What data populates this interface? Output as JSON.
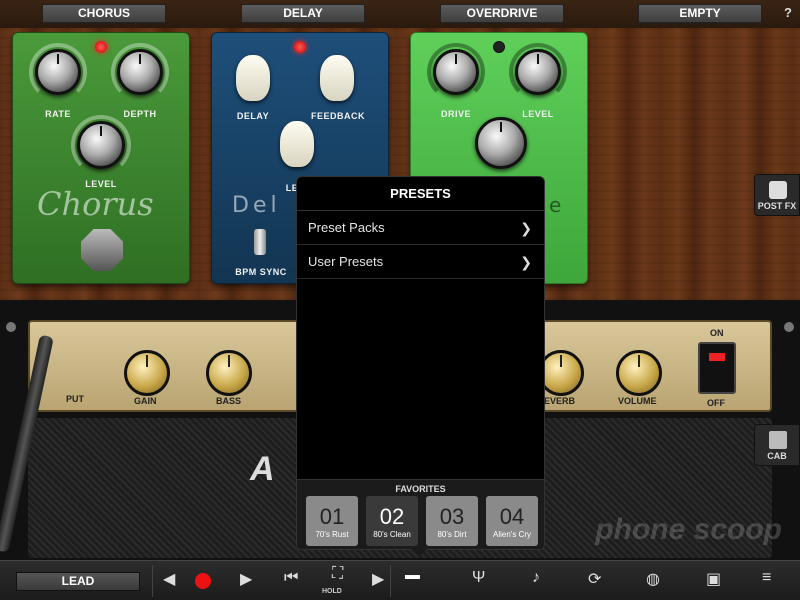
{
  "top_slots": [
    {
      "label": "CHORUS"
    },
    {
      "label": "DELAY"
    },
    {
      "label": "OVERDRIVE"
    },
    {
      "label": "EMPTY"
    }
  ],
  "help_label": "?",
  "pedals": {
    "chorus": {
      "rate": "RATE",
      "depth": "DEPTH",
      "level": "LEVEL",
      "name": "Chorus"
    },
    "delay": {
      "delay": "DELAY",
      "feedback": "FEEDBACK",
      "level": "LE",
      "name": "Del",
      "bpm_sync": "BPM SYNC"
    },
    "overdrive": {
      "drive": "DRIVE",
      "level": "LEVEL",
      "name_tail": "e"
    }
  },
  "side_buttons": {
    "post_fx": "POST FX",
    "cab": "CAB"
  },
  "amp": {
    "labels": {
      "input": "PUT",
      "gain": "GAIN",
      "bass": "BASS",
      "reverb": "EVERB",
      "volume": "VOLUME",
      "on": "ON",
      "off": "OFF"
    },
    "brand": "A"
  },
  "presets": {
    "title": "PRESETS",
    "rows": [
      {
        "label": "Preset Packs"
      },
      {
        "label": "User Presets"
      }
    ],
    "favorites_title": "FAVORITES",
    "favorites": [
      {
        "num": "01",
        "name": "70's Rust"
      },
      {
        "num": "02",
        "name": "80's Clean"
      },
      {
        "num": "03",
        "name": "80's Dirt"
      },
      {
        "num": "04",
        "name": "Alien's Cry"
      }
    ]
  },
  "toolbar": {
    "lead": "LEAD",
    "hold": "HOLD"
  },
  "watermark": "phone scoop"
}
